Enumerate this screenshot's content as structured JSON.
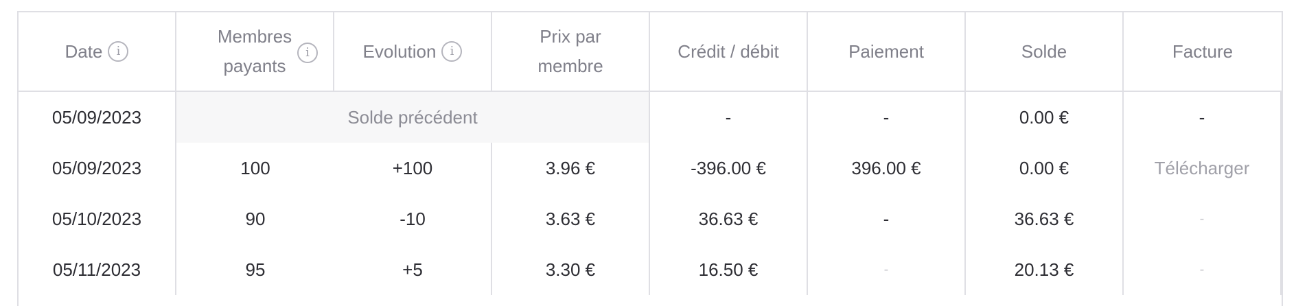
{
  "headers": [
    {
      "label": "Date",
      "info": true
    },
    {
      "label": "Membres payants",
      "info": true
    },
    {
      "label": "Evolution",
      "info": true
    },
    {
      "label": "Prix par membre",
      "info": false
    },
    {
      "label": "Crédit / débit",
      "info": false
    },
    {
      "label": "Paiement",
      "info": false
    },
    {
      "label": "Solde",
      "info": false
    },
    {
      "label": "Facture",
      "info": false
    }
  ],
  "info_glyph": "i",
  "previous_balance_label": "Solde précédent",
  "rows": [
    {
      "date": "05/09/2023",
      "credit_debit": "-",
      "payment": "-",
      "balance": "0.00 €",
      "invoice": "-"
    },
    {
      "date": "05/09/2023",
      "members": "100",
      "evolution": "+100",
      "price": "3.96 €",
      "credit_debit": "-396.00 €",
      "payment": "396.00 €",
      "balance": "0.00 €",
      "invoice": "Télécharger"
    },
    {
      "date": "05/10/2023",
      "members": "90",
      "evolution": "-10",
      "price": "3.63 €",
      "credit_debit": "36.63 €",
      "payment": "-",
      "balance": "36.63 €",
      "invoice": "-"
    },
    {
      "date": "05/11/2023",
      "members": "95",
      "evolution": "+5",
      "price": "3.30 €",
      "credit_debit": "16.50 €",
      "payment": "-",
      "balance": "20.13 €",
      "invoice": "-"
    }
  ]
}
